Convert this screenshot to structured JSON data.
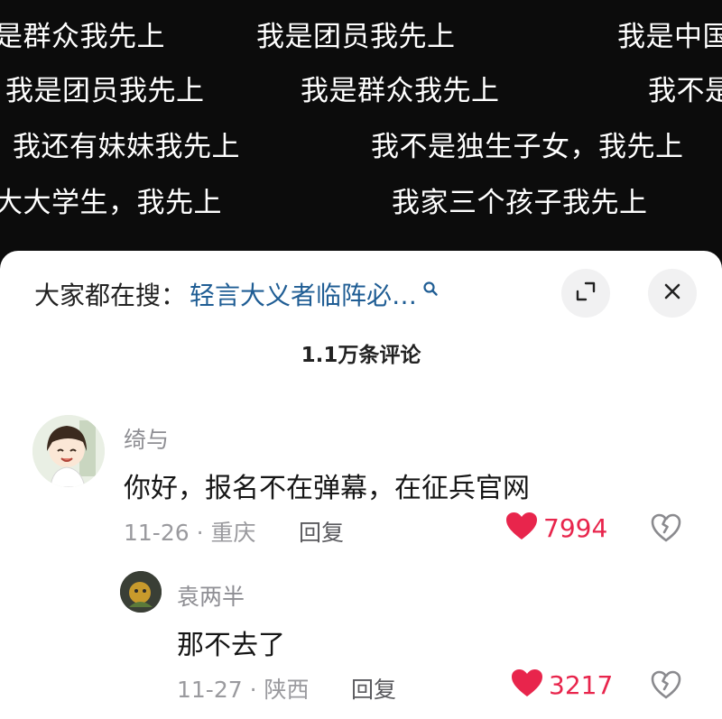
{
  "danmaku": {
    "row1": [
      "是群众我先上",
      "我是团员我先上",
      "我是中国"
    ],
    "row2": [
      "我是团员我先上",
      "我是群众我先上",
      "我不是"
    ],
    "row3": [
      "我还有妹妹我先上",
      "我不是独生子女，我先上"
    ],
    "row4": [
      "大大学生，我先上",
      "我家三个孩子我先上"
    ]
  },
  "search": {
    "label": "大家都在搜：",
    "query": "轻言大义者临阵必…"
  },
  "header": {
    "count": "1.1万条评论"
  },
  "comments": [
    {
      "user": "绮与",
      "text": "你好，报名不在弹幕，在征兵官网",
      "meta": "11-26 · 重庆",
      "reply": "回复",
      "likes": "7994"
    },
    {
      "user": "袁两半",
      "text": "那不去了",
      "meta": "11-27 · 陕西",
      "reply": "回复",
      "likes": "3217"
    }
  ],
  "colors": {
    "like": "#e8254c",
    "link": "#1f5d94",
    "video_bg": "#0c0c0c"
  },
  "icons": [
    "search-icon",
    "expand-icon",
    "close-icon",
    "heart-icon",
    "broken-heart-icon"
  ]
}
